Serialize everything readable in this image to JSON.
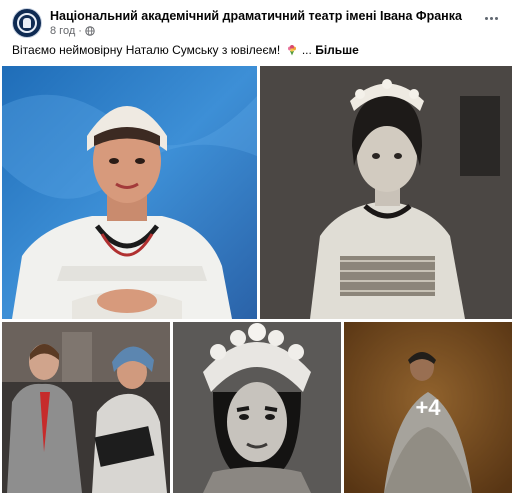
{
  "post": {
    "page_name": "Національний академічний драматичний театр імені Івана Франка",
    "time": "8 год",
    "separator": "·",
    "text": "Вітаємо неймовірну Наталю Сумську з ювілеєм!",
    "ellipsis": "...",
    "see_more": "Більше"
  },
  "gallery": {
    "more_count": "+4"
  },
  "icons": {
    "avatar": "theatre-logo",
    "privacy": "globe-icon",
    "emoji": "bouquet-icon",
    "menu": "more-options-icon"
  },
  "colors": {
    "secondary_text": "#65676b",
    "primary_text": "#050505",
    "overlay": "#000000"
  }
}
